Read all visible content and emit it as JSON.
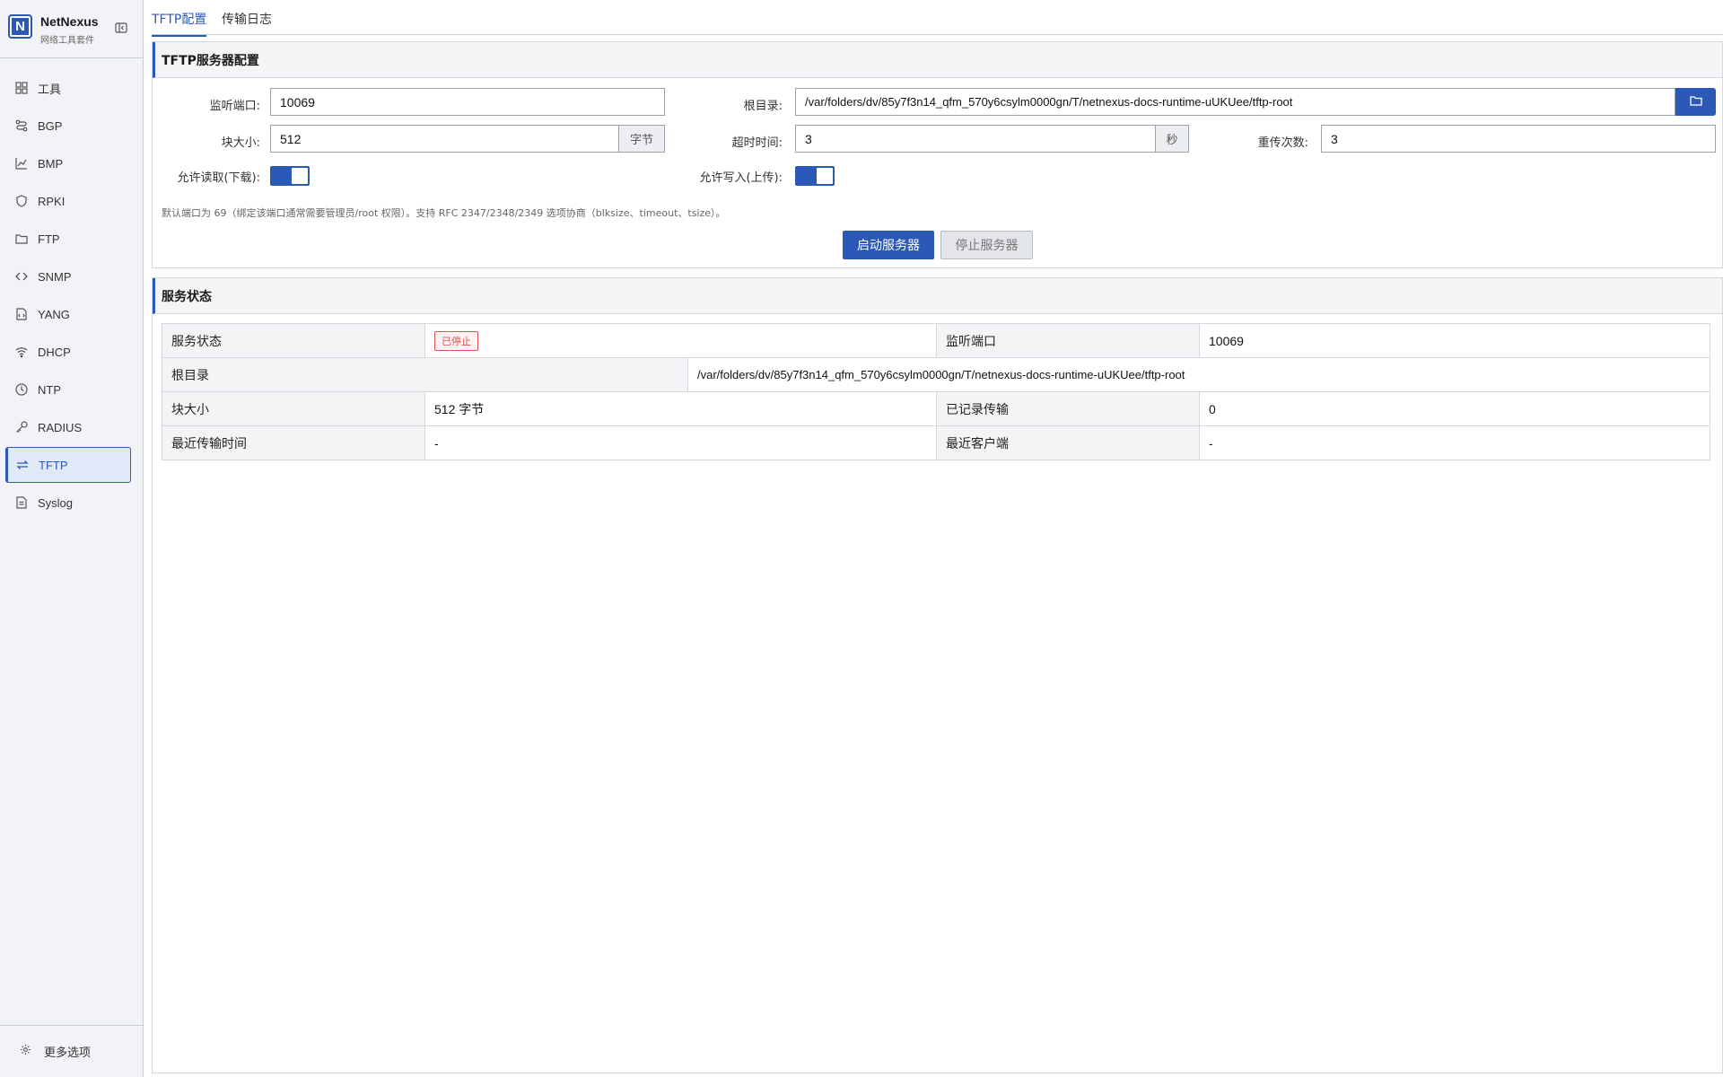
{
  "app": {
    "name": "NetNexus",
    "subtitle": "网络工具套件"
  },
  "sidebar": {
    "items": [
      {
        "label": "工具",
        "icon": "grid-icon",
        "active": false
      },
      {
        "label": "BGP",
        "icon": "route-icon",
        "active": false
      },
      {
        "label": "BMP",
        "icon": "chart-line-icon",
        "active": false
      },
      {
        "label": "RPKI",
        "icon": "shield-icon",
        "active": false
      },
      {
        "label": "FTP",
        "icon": "folder-icon",
        "active": false
      },
      {
        "label": "SNMP",
        "icon": "code-icon",
        "active": false
      },
      {
        "label": "YANG",
        "icon": "file-code-icon",
        "active": false
      },
      {
        "label": "DHCP",
        "icon": "wifi-icon",
        "active": false
      },
      {
        "label": "NTP",
        "icon": "clock-icon",
        "active": false
      },
      {
        "label": "RADIUS",
        "icon": "key-icon",
        "active": false
      },
      {
        "label": "TFTP",
        "icon": "transfer-icon",
        "active": true
      },
      {
        "label": "Syslog",
        "icon": "document-icon",
        "active": false
      }
    ],
    "footer": {
      "label": "更多选项",
      "icon": "gear-icon"
    }
  },
  "tabs": [
    {
      "label": "TFTP配置",
      "active": true
    },
    {
      "label": "传输日志",
      "active": false
    }
  ],
  "config": {
    "title": "TFTP服务器配置",
    "port_label": "监听端口:",
    "port_value": "10069",
    "root_label": "根目录:",
    "root_value": "/var/folders/dv/85y7f3n14_qfm_570y6csylm0000gn/T/netnexus-docs-runtime-uUKUee/tftp-root",
    "blocksize_label": "块大小:",
    "blocksize_value": "512",
    "blocksize_unit": "字节",
    "timeout_label": "超时时间:",
    "timeout_value": "3",
    "timeout_unit": "秒",
    "retries_label": "重传次数:",
    "retries_value": "3",
    "allow_read_label": "允许读取(下载):",
    "allow_read": true,
    "allow_write_label": "允许写入(上传):",
    "allow_write": true,
    "hint": "默认端口为 69（绑定该端口通常需要管理员/root 权限）。支持 RFC 2347/2348/2349 选项协商（blksize、timeout、tsize）。",
    "start_button": "启动服务器",
    "stop_button": "停止服务器"
  },
  "status": {
    "title": "服务状态",
    "state_label": "服务状态",
    "state_value": "已停止",
    "port_label": "监听端口",
    "port_value": "10069",
    "root_label": "根目录",
    "root_value": "/var/folders/dv/85y7f3n14_qfm_570y6csylm0000gn/T/netnexus-docs-runtime-uUKUee/tftp-root",
    "blocksize_label": "块大小",
    "blocksize_value": "512 字节",
    "transfers_label": "已记录传输",
    "transfers_value": "0",
    "last_time_label": "最近传输时间",
    "last_time_value": "-",
    "last_client_label": "最近客户端",
    "last_client_value": "-"
  },
  "colors": {
    "accent": "#2c59b8",
    "danger": "#d9534f"
  }
}
